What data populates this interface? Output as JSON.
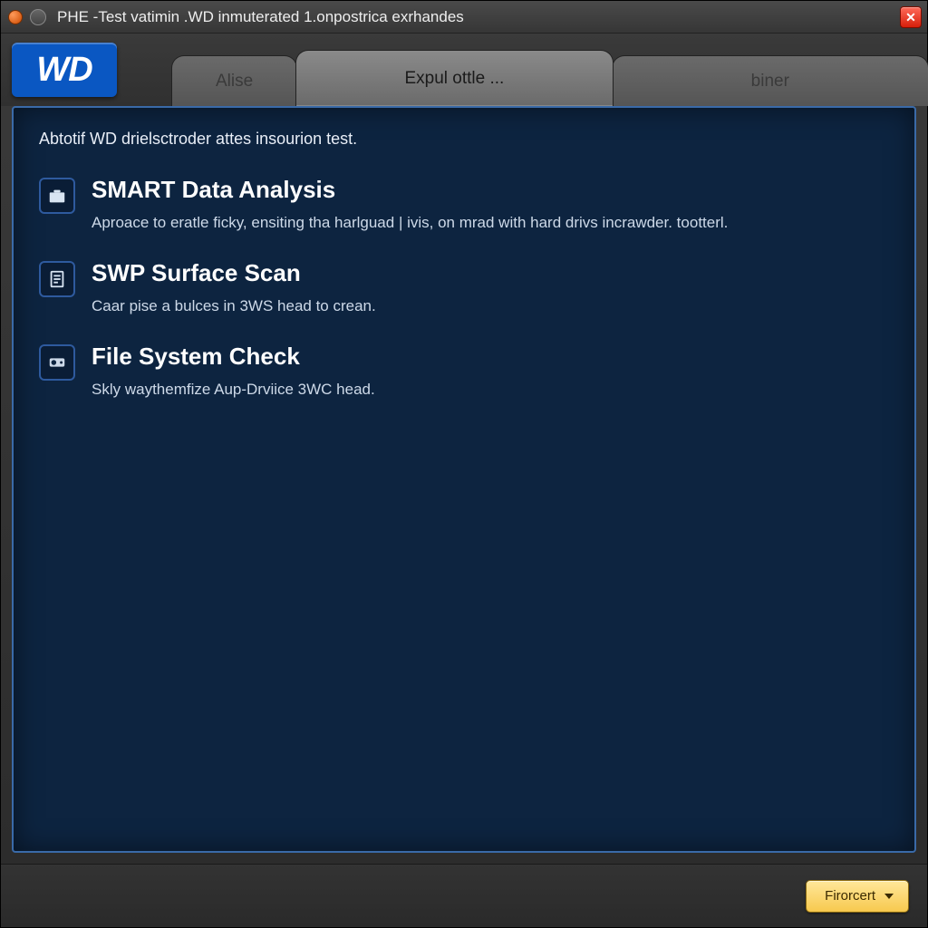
{
  "window": {
    "title": "PHE -Test vatimin .WD inmuterated 1.onpostrica exrhandes"
  },
  "logo_text": "WD",
  "tabs": [
    {
      "label": "Alise",
      "active": false
    },
    {
      "label": "Expul ottle ...",
      "active": true
    },
    {
      "label": "biner",
      "active": false
    }
  ],
  "intro": "Abtotif WD drielsctroder attes insourion test.",
  "options": [
    {
      "icon": "briefcase-icon",
      "title": "SMART Data Analysis",
      "desc": "Aproace to eratle ficky, ensiting tha harlguad | ivis, on mrad with hard drivs incrawder. tootterl."
    },
    {
      "icon": "document-icon",
      "title": "SWP Surface Scan",
      "desc": "Caar pise a bulces in 3WS head to crean."
    },
    {
      "icon": "drive-icon",
      "title": "File System Check",
      "desc": "Skly waythemfize Aup-Drviice 3WC head."
    }
  ],
  "footer": {
    "primary_label": "Firorcert"
  }
}
